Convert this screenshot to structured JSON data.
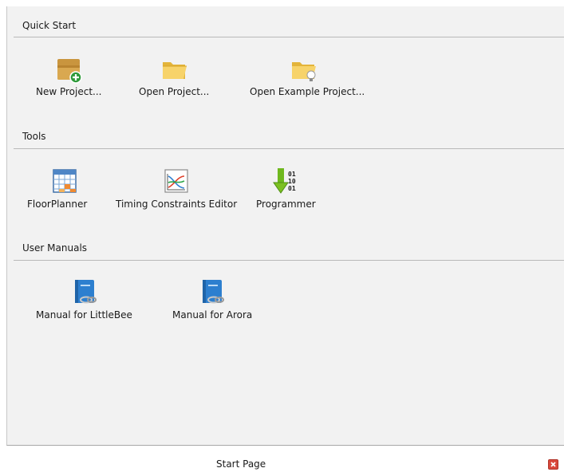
{
  "sections": {
    "quick_start": {
      "title": "Quick Start",
      "items": [
        {
          "label": "New Project...",
          "icon": "new-project-icon"
        },
        {
          "label": "Open Project...",
          "icon": "open-folder-icon"
        },
        {
          "label": "Open Example Project...",
          "icon": "example-folder-icon"
        }
      ]
    },
    "tools": {
      "title": "Tools",
      "items": [
        {
          "label": "FloorPlanner",
          "icon": "floorplanner-icon"
        },
        {
          "label": "Timing Constraints Editor",
          "icon": "timing-chart-icon"
        },
        {
          "label": "Programmer",
          "icon": "programmer-download-icon"
        }
      ]
    },
    "user_manuals": {
      "title": "User Manuals",
      "items": [
        {
          "label": "Manual for LittleBee",
          "icon": "manual-book-icon"
        },
        {
          "label": "Manual for Arora",
          "icon": "manual-book-icon"
        }
      ]
    }
  },
  "tab": {
    "label": "Start Page",
    "close_icon": "close-icon"
  },
  "colors": {
    "panel_bg": "#f2f2f2",
    "folder": "#f2c64a",
    "book": "#2d7fcf",
    "arrow": "#7cc021",
    "close": "#d9483b"
  }
}
